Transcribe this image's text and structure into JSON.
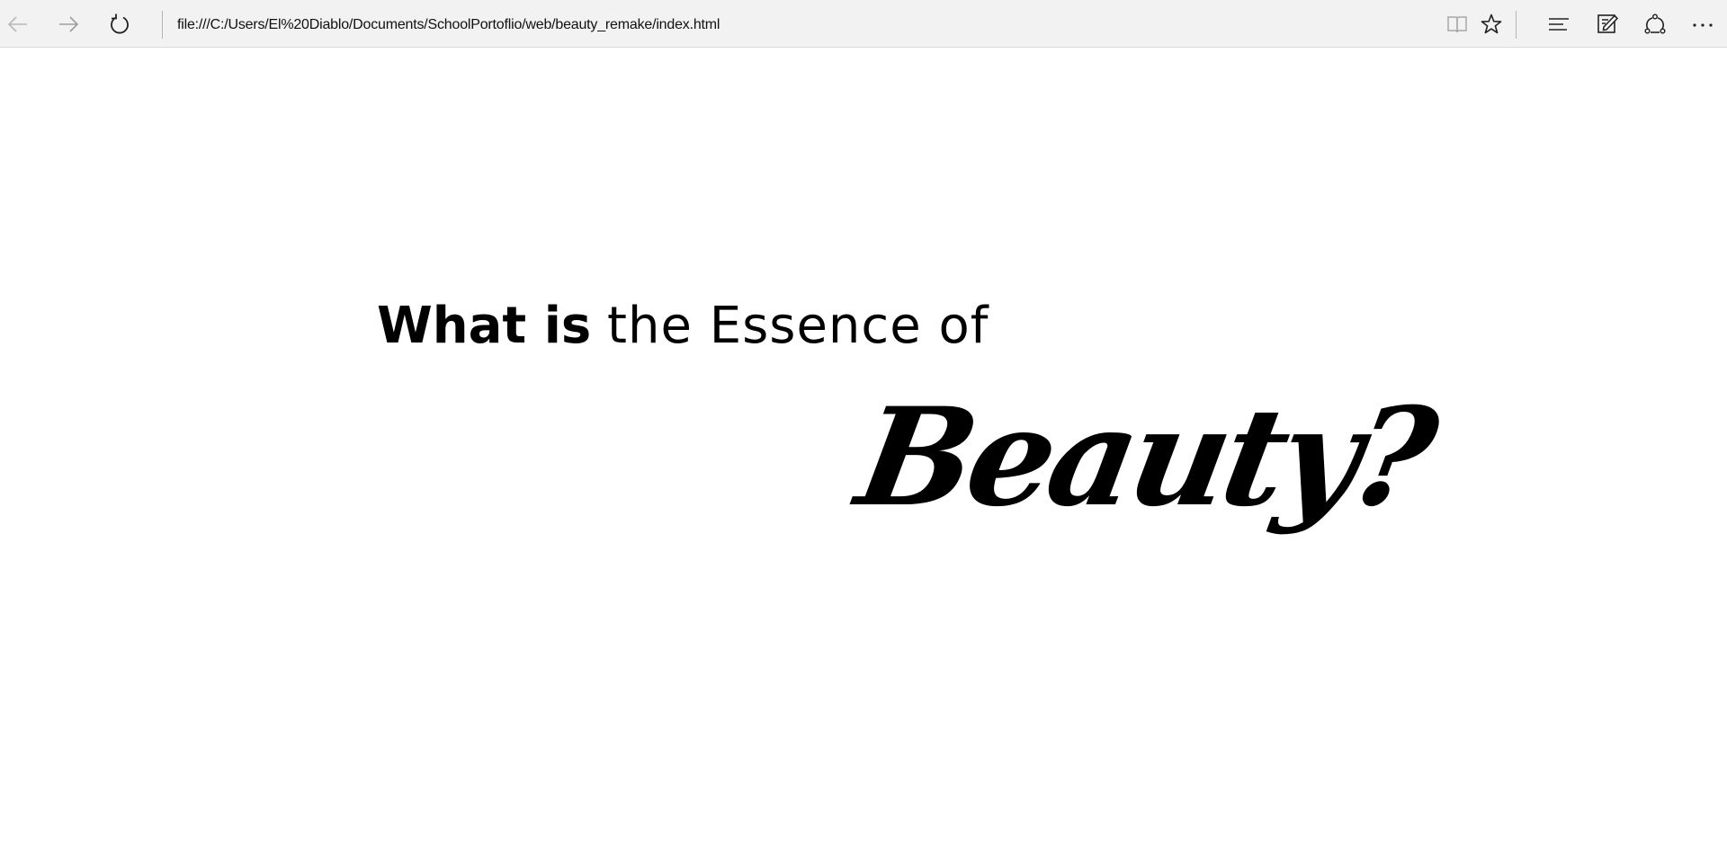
{
  "browser": {
    "address": "file:///C:/Users/El%20Diablo/Documents/SchoolPortoflio/web/beauty_remake/index.html",
    "icons": {
      "back": "back-arrow-icon",
      "forward": "forward-arrow-icon",
      "refresh": "refresh-icon",
      "reading_view": "reading-view-icon",
      "favorite": "star-icon",
      "hub": "hub-icon",
      "web_note": "web-note-icon",
      "share": "share-icon",
      "more": "more-icon"
    }
  },
  "page": {
    "headline_bold": "What is",
    "headline_rest": "the Essence of",
    "beauty": "Beauty?"
  }
}
